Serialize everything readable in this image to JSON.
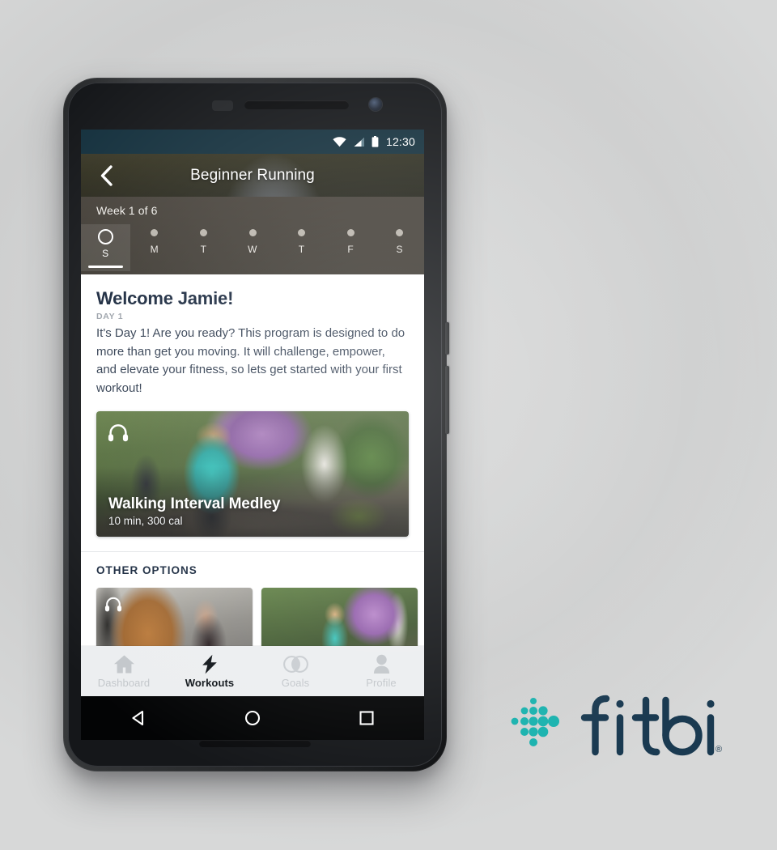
{
  "brand": {
    "name": "fitbit",
    "registered_mark": "®",
    "dot_color": "#19b2ae",
    "wordmark_color": "#1a3a51"
  },
  "phone": {
    "statusbar": {
      "time": "12:30",
      "bar_color": "#14303d",
      "icons": [
        "wifi-icon",
        "cellular-signal-icon",
        "battery-icon"
      ]
    },
    "android_nav": {
      "back_label": "Back",
      "home_label": "Home",
      "recents_label": "Recent apps"
    }
  },
  "app": {
    "header": {
      "title": "Beginner Running",
      "back_icon": "back-chevron-icon"
    },
    "week": {
      "label": "Week 1 of 6",
      "days": [
        {
          "letter": "S",
          "selected": true
        },
        {
          "letter": "M",
          "selected": false
        },
        {
          "letter": "T",
          "selected": false
        },
        {
          "letter": "W",
          "selected": false
        },
        {
          "letter": "T",
          "selected": false
        },
        {
          "letter": "F",
          "selected": false
        },
        {
          "letter": "S",
          "selected": false
        }
      ]
    },
    "welcome": {
      "title": "Welcome Jamie!",
      "day_label": "DAY 1",
      "body": "It's Day 1! Are you ready? This program is designed to do more than get you moving. It will challenge, empower, and elevate your fitness, so lets get started with your first workout!"
    },
    "featured_workout": {
      "title": "Walking Interval Medley",
      "meta": "10 min, 300 cal",
      "audio_icon": "headphones-icon"
    },
    "other_options": {
      "section_title": "OTHER OPTIONS",
      "thumbnails": [
        {
          "audio_icon": "headphones-icon"
        },
        {
          "audio_icon": ""
        },
        {
          "audio_icon": ""
        }
      ]
    },
    "tabs": [
      {
        "label": "Dashboard",
        "icon": "home-icon",
        "active": false
      },
      {
        "label": "Workouts",
        "icon": "lightning-bolt-icon",
        "active": true
      },
      {
        "label": "Goals",
        "icon": "overlapping-circles-icon",
        "active": false
      },
      {
        "label": "Profile",
        "icon": "person-icon",
        "active": false
      }
    ]
  }
}
